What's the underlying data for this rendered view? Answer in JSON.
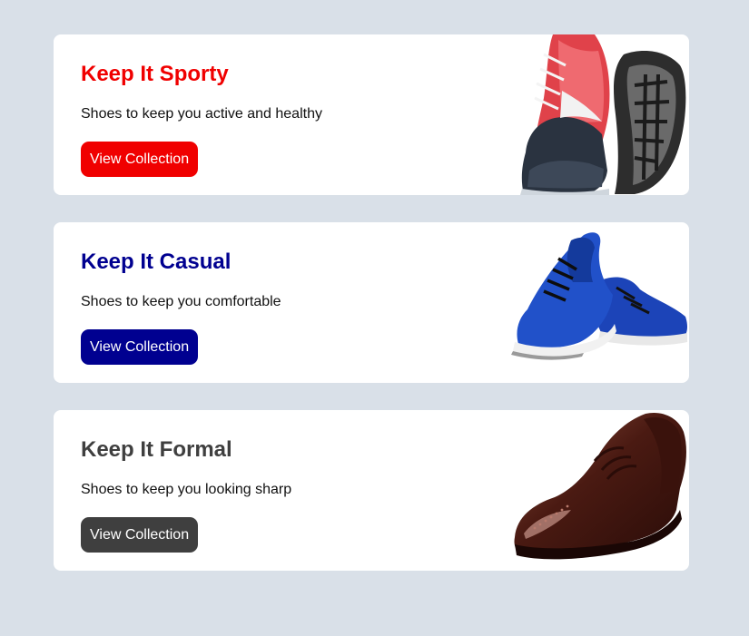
{
  "cards": [
    {
      "title": "Keep It Sporty",
      "description": "Shoes to keep you active and healthy",
      "button_label": "View Collection",
      "accent_color": "#f00000",
      "image_icon": "sport-sneaker-icon"
    },
    {
      "title": "Keep It Casual",
      "description": "Shoes to keep you comfortable",
      "button_label": "View Collection",
      "accent_color": "#000090",
      "image_icon": "casual-sneaker-icon"
    },
    {
      "title": "Keep It Formal",
      "description": "Shoes to keep you looking sharp",
      "button_label": "View Collection",
      "accent_color": "#3f3f3f",
      "image_icon": "formal-shoe-icon"
    }
  ]
}
